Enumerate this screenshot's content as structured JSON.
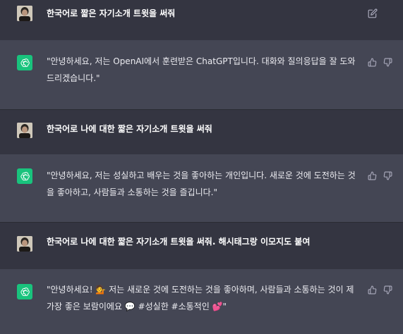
{
  "conversation": {
    "messages": [
      {
        "role": "user",
        "text": "한국어로 짧은 자기소개 트윗을 써줘"
      },
      {
        "role": "assistant",
        "text": "\"안녕하세요, 저는 OpenAI에서 훈련받은 ChatGPT입니다. 대화와 질의응답을 잘 도와드리겠습니다.\""
      },
      {
        "role": "user",
        "text": "한국어로 나에 대한 짧은 자기소개 트윗을 써줘"
      },
      {
        "role": "assistant",
        "text": "\"안녕하세요, 저는 성실하고 배우는 것을 좋아하는 개인입니다. 새로운 것에 도전하는 것을 좋아하고, 사람들과 소통하는 것을 즐깁니다.\""
      },
      {
        "role": "user",
        "text": "한국어로 나에 대한 짧은 자기소개 트윗을 써줘. 해시태그랑 이모지도 붙여"
      },
      {
        "role": "assistant",
        "text": "\"안녕하세요! 💁 저는 새로운 것에 도전하는 것을 좋아하며, 사람들과 소통하는 것이 제 가장 좋은 보람이에요 💬 #성실한 #소통적인 💕\""
      }
    ]
  },
  "icons": {
    "edit": "edit-icon",
    "thumbs_up": "thumbs-up-icon",
    "thumbs_down": "thumbs-down-icon",
    "assistant_logo": "openai-logo-icon",
    "user_avatar": "user-avatar"
  },
  "colors": {
    "user_bg": "#343541",
    "assistant_bg": "#444654",
    "assistant_avatar": "#19c37d",
    "text": "#ececf1",
    "icon": "#acacbe"
  }
}
